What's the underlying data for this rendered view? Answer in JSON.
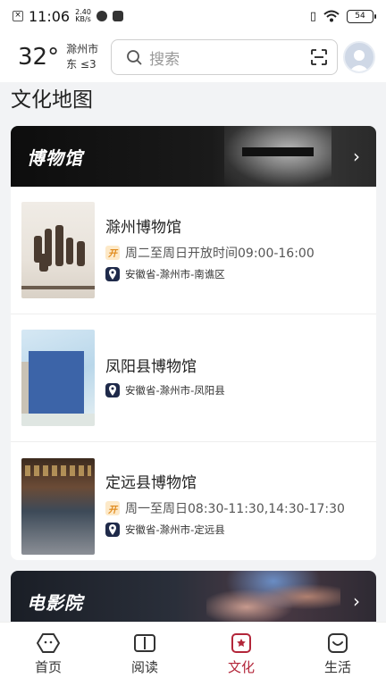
{
  "status_bar": {
    "time": "11:06",
    "speed_value": "2.40",
    "speed_unit": "KB/s",
    "battery": "54"
  },
  "header": {
    "temperature": "32°",
    "location_line1": "滁州市",
    "location_line2": "东 ≤3",
    "search_placeholder": "搜索"
  },
  "page_title": "文化地图",
  "museum_section": {
    "title": "博物馆",
    "items": [
      {
        "name": "滁州博物馆",
        "hours": "周二至周日开放时间09:00-16:00",
        "address": "安徽省-滁州市-南谯区"
      },
      {
        "name": "凤阳县博物馆",
        "address": "安徽省-滁州市-凤阳县"
      },
      {
        "name": "定远县博物馆",
        "hours": "周一至周日08:30-11:30,14:30-17:30",
        "address": "安徽省-滁州市-定远县"
      }
    ]
  },
  "cinema_section": {
    "title": "电影院"
  },
  "bottom_nav": {
    "items": [
      {
        "label": "首页",
        "icon": "home-icon"
      },
      {
        "label": "阅读",
        "icon": "book-icon"
      },
      {
        "label": "文化",
        "icon": "culture-icon"
      },
      {
        "label": "生活",
        "icon": "life-icon"
      }
    ],
    "active": "文化"
  },
  "colors": {
    "accent": "#b3263a",
    "banner_dark": "#111111",
    "location_badge": "#1f2a4a",
    "open_badge": "#e08a1c"
  }
}
